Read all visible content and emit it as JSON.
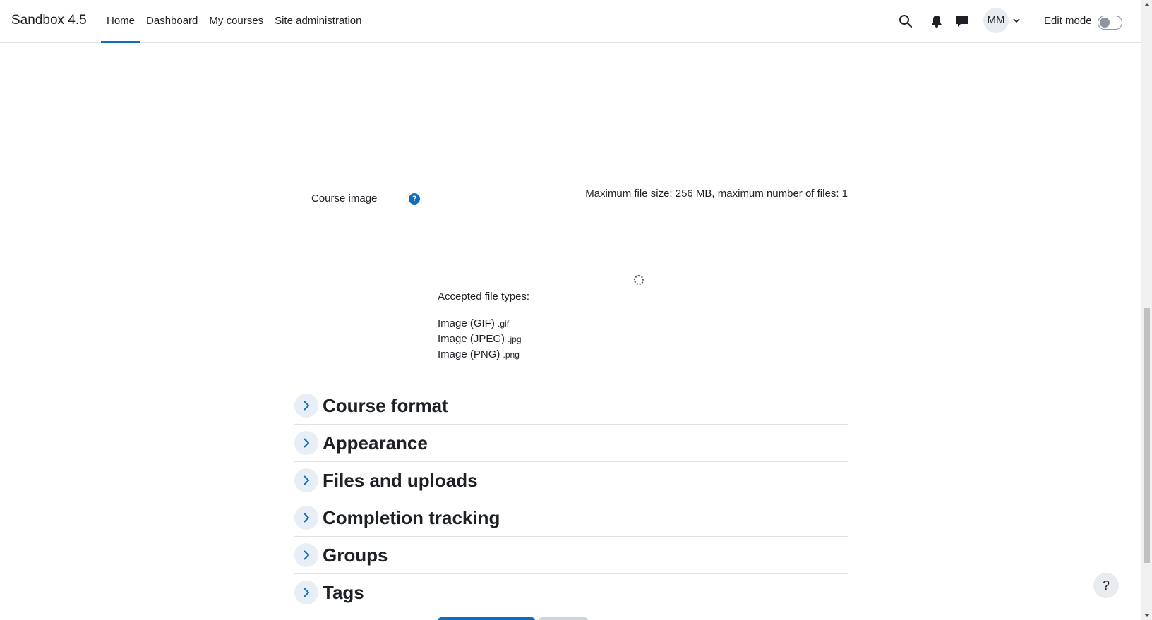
{
  "site": {
    "brand": "Sandbox 4.5"
  },
  "nav": {
    "items": [
      {
        "label": "Home",
        "active": true
      },
      {
        "label": "Dashboard"
      },
      {
        "label": "My courses"
      },
      {
        "label": "Site administration"
      }
    ]
  },
  "user": {
    "initials": "MM"
  },
  "edit_mode": {
    "label": "Edit mode",
    "enabled": false
  },
  "icons": [
    "search-icon",
    "bell-icon",
    "chat-icon",
    "chevron-down-icon",
    "help-icon",
    "spinner-icon",
    "chevron-right-icon"
  ],
  "course_image": {
    "label": "Course image",
    "help": "?",
    "limits": "Maximum file size: 256 MB, maximum number of files: 1",
    "accepted_label": "Accepted file types:",
    "types": [
      {
        "name": "Image (GIF)",
        "ext": ".gif"
      },
      {
        "name": "Image (JPEG)",
        "ext": ".jpg"
      },
      {
        "name": "Image (PNG)",
        "ext": ".png"
      }
    ]
  },
  "sections": [
    "Course format",
    "Appearance",
    "Files and uploads",
    "Completion tracking",
    "Groups",
    "Tags"
  ],
  "float_help": "?",
  "colors": {
    "accent": "#0f6cbf",
    "text": "#1d2125",
    "border": "#dee2e6"
  }
}
